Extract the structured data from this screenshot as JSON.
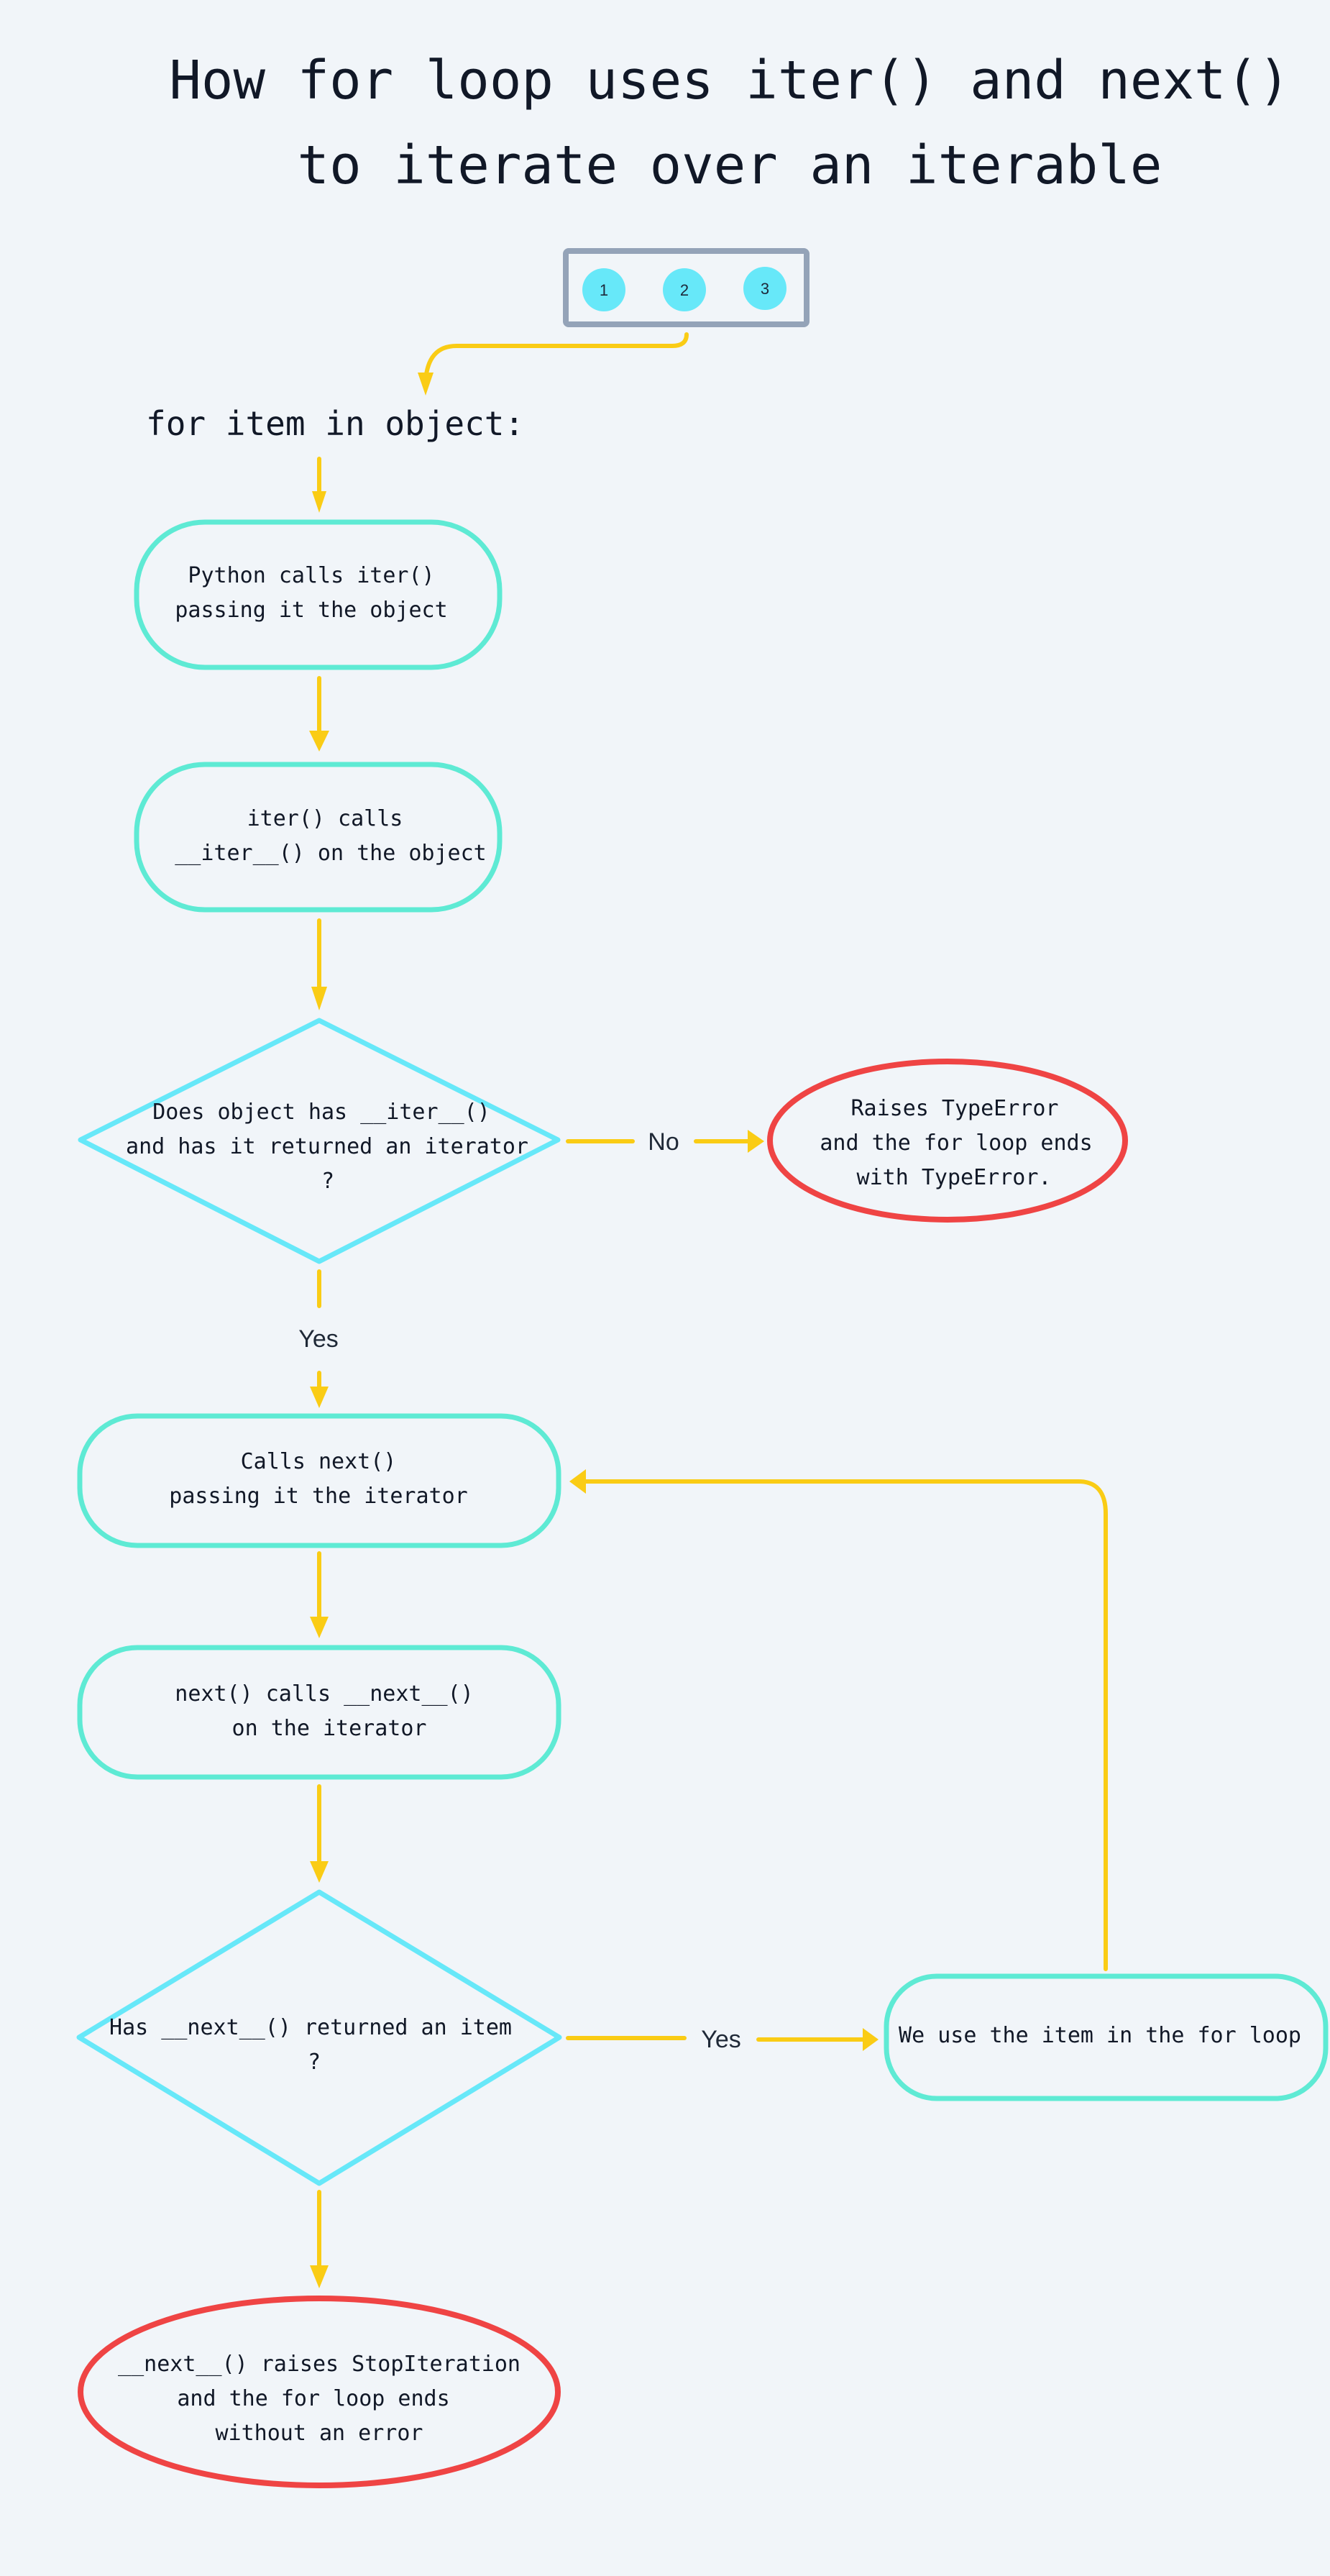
{
  "title": {
    "line1": "How for loop uses iter() and next()",
    "line2": "to iterate over an iterable"
  },
  "iterable": {
    "items": [
      "1",
      "2",
      "3"
    ]
  },
  "code_line": "for item in object:",
  "nodes": {
    "call_iter": {
      "lines": [
        "Python calls iter()",
        "passing it the object"
      ]
    },
    "iter_calls_dunder": {
      "lines": [
        "iter() calls",
        "__iter__() on the object"
      ]
    },
    "has_iter_decision": {
      "lines": [
        "Does object has __iter__()",
        "and has it returned an iterator",
        "?"
      ]
    },
    "type_error": {
      "lines": [
        "Raises TypeError",
        "and the for loop ends",
        "with TypeError."
      ]
    },
    "call_next": {
      "lines": [
        "Calls next()",
        "passing it the iterator"
      ]
    },
    "next_calls_dunder": {
      "lines": [
        "next() calls __next__()",
        "on the iterator"
      ]
    },
    "returned_item_decision": {
      "lines": [
        "Has __next__() returned an item",
        "?"
      ]
    },
    "use_item": {
      "lines": [
        "We use the item in the for loop"
      ]
    },
    "stop_iteration": {
      "lines": [
        "__next__() raises StopIteration",
        "and the for loop ends",
        "without an error"
      ]
    }
  },
  "edge_labels": {
    "no": "No",
    "yes_down": "Yes",
    "yes_right": "Yes"
  },
  "colors": {
    "background": "#f1f5f9",
    "edge": "#facc15",
    "process": "#5eead4",
    "decision": "#67e8f9",
    "terminal": "#ef4444",
    "array_frame": "#94a3b8",
    "text": "#111827"
  }
}
